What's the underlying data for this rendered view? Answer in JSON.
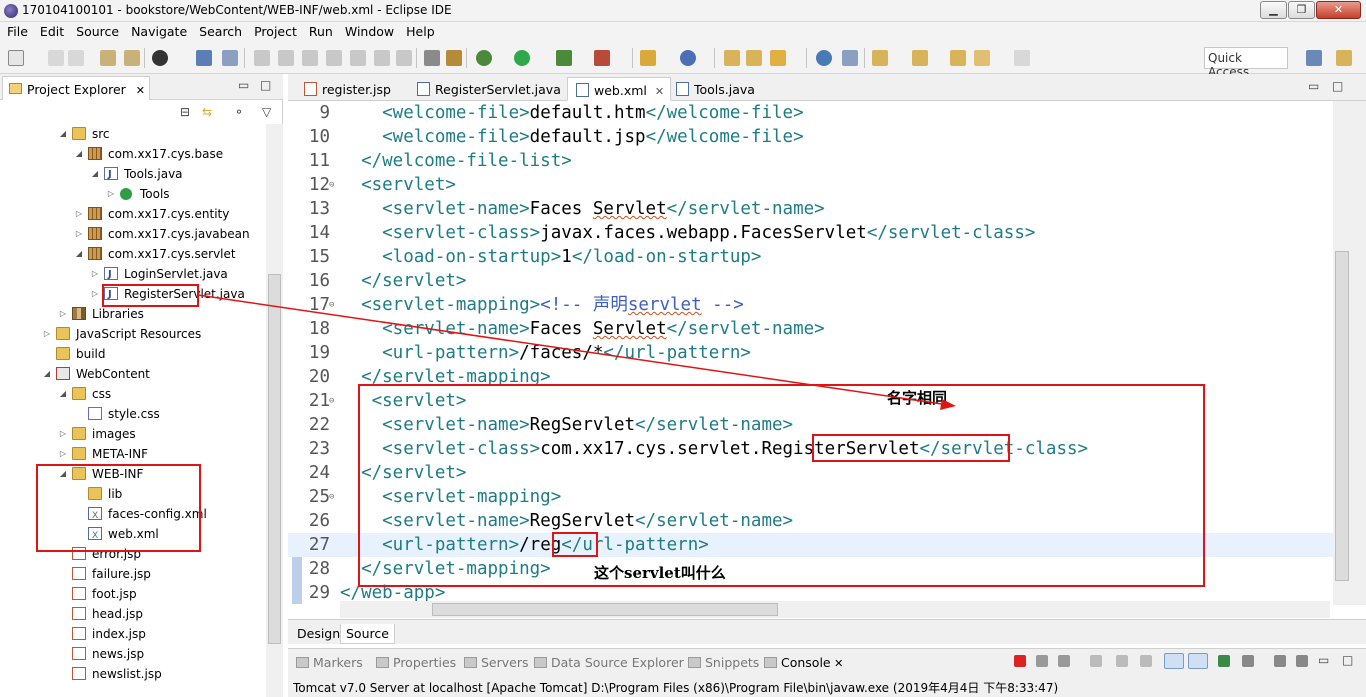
{
  "window": {
    "title": "170104100101 - bookstore/WebContent/WEB-INF/web.xml - Eclipse IDE"
  },
  "menu": [
    "File",
    "Edit",
    "Source",
    "Navigate",
    "Search",
    "Project",
    "Run",
    "Window",
    "Help"
  ],
  "toolbar": {
    "quick_access": "Quick Access"
  },
  "explorer": {
    "title": "Project Explorer",
    "items": [
      {
        "label": "src",
        "icon": "source-folder-icon"
      },
      {
        "label": "com.xx17.cys.base",
        "icon": "package-icon"
      },
      {
        "label": "Tools.java",
        "icon": "java-file-icon"
      },
      {
        "label": "Tools",
        "icon": "class-icon"
      },
      {
        "label": "com.xx17.cys.entity",
        "icon": "package-icon"
      },
      {
        "label": "com.xx17.cys.javabean",
        "icon": "package-icon"
      },
      {
        "label": "com.xx17.cys.servlet",
        "icon": "package-icon"
      },
      {
        "label": "LoginServlet.java",
        "icon": "java-file-icon"
      },
      {
        "label": "RegisterServlet.java",
        "icon": "java-file-icon"
      },
      {
        "label": "Libraries",
        "icon": "library-icon"
      },
      {
        "label": "JavaScript Resources",
        "icon": "js-resources-icon"
      },
      {
        "label": "build",
        "icon": "folder-icon"
      },
      {
        "label": "WebContent",
        "icon": "web-content-icon"
      },
      {
        "label": "css",
        "icon": "folder-icon"
      },
      {
        "label": "style.css",
        "icon": "css-file-icon"
      },
      {
        "label": "images",
        "icon": "folder-icon"
      },
      {
        "label": "META-INF",
        "icon": "folder-icon"
      },
      {
        "label": "WEB-INF",
        "icon": "folder-icon"
      },
      {
        "label": "lib",
        "icon": "folder-icon"
      },
      {
        "label": "faces-config.xml",
        "icon": "xml-file-icon"
      },
      {
        "label": "web.xml",
        "icon": "xml-file-icon"
      },
      {
        "label": "error.jsp",
        "icon": "jsp-file-icon"
      },
      {
        "label": "failure.jsp",
        "icon": "jsp-file-icon"
      },
      {
        "label": "foot.jsp",
        "icon": "jsp-file-icon"
      },
      {
        "label": "head.jsp",
        "icon": "jsp-file-icon"
      },
      {
        "label": "index.jsp",
        "icon": "jsp-file-icon"
      },
      {
        "label": "news.jsp",
        "icon": "jsp-file-icon"
      },
      {
        "label": "newslist.jsp",
        "icon": "jsp-file-icon"
      }
    ]
  },
  "editor": {
    "tabs": [
      {
        "label": "register.jsp",
        "active": false
      },
      {
        "label": "RegisterServlet.java",
        "active": false
      },
      {
        "label": "web.xml",
        "active": true
      },
      {
        "label": "Tools.java",
        "active": false
      }
    ],
    "lines": [
      {
        "n": "9",
        "segs": [
          [
            "t",
            "    <welcome-file>"
          ],
          [
            "x",
            "default.htm"
          ],
          [
            "t",
            "</welcome-file>"
          ]
        ]
      },
      {
        "n": "10",
        "segs": [
          [
            "t",
            "    <welcome-file>"
          ],
          [
            "x",
            "default.jsp"
          ],
          [
            "t",
            "</welcome-file>"
          ]
        ]
      },
      {
        "n": "11",
        "segs": [
          [
            "t",
            "  </welcome-file-list>"
          ]
        ]
      },
      {
        "n": "12",
        "fold": true,
        "segs": [
          [
            "t",
            "  <servlet>"
          ]
        ]
      },
      {
        "n": "13",
        "segs": [
          [
            "t",
            "    <servlet-name>"
          ],
          [
            "x",
            "Faces "
          ],
          [
            "s",
            "Servlet"
          ],
          [
            "t",
            "</servlet-name>"
          ]
        ]
      },
      {
        "n": "14",
        "segs": [
          [
            "t",
            "    <servlet-class>"
          ],
          [
            "x",
            "javax.faces.webapp.FacesServlet"
          ],
          [
            "t",
            "</servlet-class>"
          ]
        ]
      },
      {
        "n": "15",
        "segs": [
          [
            "t",
            "    <load-on-startup>"
          ],
          [
            "x",
            "1"
          ],
          [
            "t",
            "</load-on-startup>"
          ]
        ]
      },
      {
        "n": "16",
        "segs": [
          [
            "t",
            "  </servlet>"
          ]
        ]
      },
      {
        "n": "17",
        "fold": true,
        "segs": [
          [
            "t",
            "  <servlet-mapping>"
          ],
          [
            "c",
            "<!-- 声明"
          ],
          [
            "cs",
            "servlet"
          ],
          [
            "c",
            " -->"
          ]
        ]
      },
      {
        "n": "18",
        "segs": [
          [
            "t",
            "    <servlet-name>"
          ],
          [
            "x",
            "Faces "
          ],
          [
            "s",
            "Servlet"
          ],
          [
            "t",
            "</servlet-name>"
          ]
        ]
      },
      {
        "n": "19",
        "segs": [
          [
            "t",
            "    <url-pattern>"
          ],
          [
            "x",
            "/faces/*"
          ],
          [
            "t",
            "</url-pattern>"
          ]
        ]
      },
      {
        "n": "20",
        "segs": [
          [
            "t",
            "  </servlet-mapping>"
          ]
        ]
      },
      {
        "n": "21",
        "fold": true,
        "segs": [
          [
            "t",
            "   <servlet>"
          ]
        ]
      },
      {
        "n": "22",
        "segs": [
          [
            "t",
            "    <servlet-name>"
          ],
          [
            "x",
            "RegServlet"
          ],
          [
            "t",
            "</servlet-name>"
          ]
        ]
      },
      {
        "n": "23",
        "segs": [
          [
            "t",
            "    <servlet-class>"
          ],
          [
            "x",
            "com.xx17.cys.servlet.RegisterServlet"
          ],
          [
            "t",
            "</servlet-class>"
          ]
        ]
      },
      {
        "n": "24",
        "segs": [
          [
            "t",
            "  </servlet>"
          ]
        ]
      },
      {
        "n": "25",
        "fold": true,
        "segs": [
          [
            "t",
            "    <servlet-mapping>"
          ]
        ]
      },
      {
        "n": "26",
        "segs": [
          [
            "t",
            "    <servlet-name>"
          ],
          [
            "x",
            "RegServlet"
          ],
          [
            "t",
            "</servlet-name>"
          ]
        ]
      },
      {
        "n": "27",
        "hl": true,
        "segs": [
          [
            "t",
            "    <url-pattern>"
          ],
          [
            "x",
            "/reg"
          ],
          [
            "t",
            "</url-pattern>"
          ]
        ]
      },
      {
        "n": "28",
        "segs": [
          [
            "t",
            "  </servlet-mapping>"
          ]
        ]
      },
      {
        "n": "29",
        "segs": [
          [
            "t",
            "</web-app>"
          ]
        ]
      }
    ],
    "design_tab": "Design",
    "source_tab": "Source"
  },
  "annotations": {
    "same_name": "名字相同",
    "which_servlet": "这个servlet叫什么"
  },
  "bottom": {
    "tabs": [
      "Markers",
      "Properties",
      "Servers",
      "Data Source Explorer",
      "Snippets",
      "Console"
    ],
    "active_tab": "Console",
    "console_text": "Tomcat v7.0 Server at localhost [Apache Tomcat] D:\\Program Files (x86)\\Program File\\bin\\javaw.exe (2019年4月4日 下午8:33:47)"
  },
  "colors": {
    "tag": "#1d7c86",
    "comment": "#3f5fbf",
    "annotation_red": "#e01414",
    "line_highlight": "#e8f2fe"
  }
}
